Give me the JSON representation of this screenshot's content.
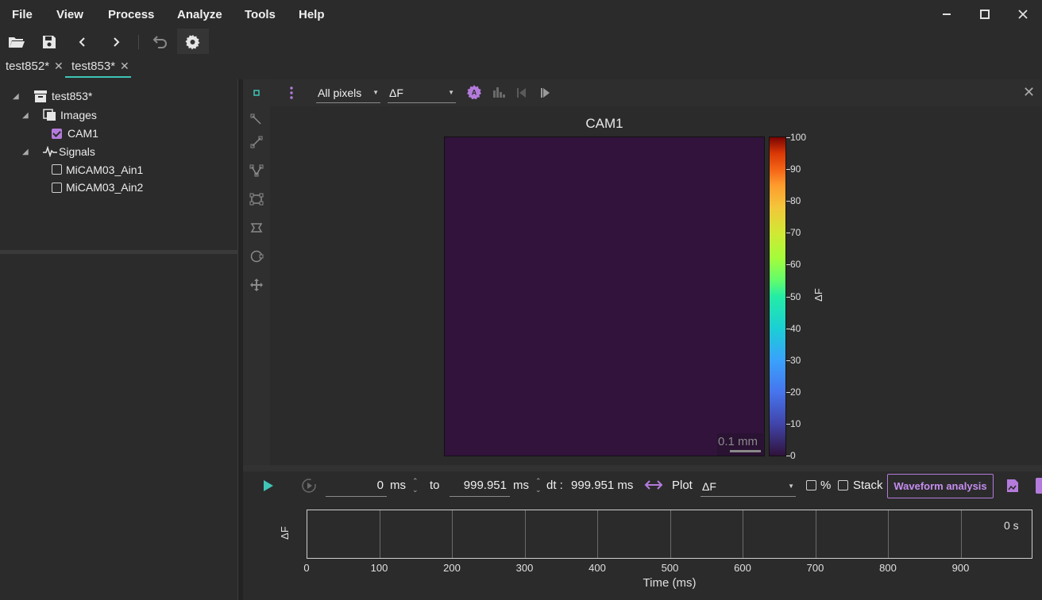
{
  "menu": {
    "items": [
      "File",
      "View",
      "Process",
      "Analyze",
      "Tools",
      "Help"
    ]
  },
  "window": {
    "minimize": "─",
    "maximize": "☐",
    "close": "✕"
  },
  "tabs": [
    {
      "label": "test852*"
    },
    {
      "label": "test853*"
    }
  ],
  "tree": {
    "root": "test853*",
    "images_label": "Images",
    "cam": "CAM1",
    "signals_label": "Signals",
    "signal1": "MiCAM03_Ain1",
    "signal2": "MiCAM03_Ain2"
  },
  "viewer": {
    "pixel_select": "All pixels",
    "mode_select": "ΔF",
    "title": "CAM1",
    "scalebar": "0.1 mm",
    "colorbar_ticks": [
      "100",
      "90",
      "80",
      "70",
      "60",
      "50",
      "40",
      "30",
      "20",
      "10",
      "0"
    ],
    "colorbar_label": "ΔF"
  },
  "controls": {
    "start_value": "0",
    "start_unit": "ms",
    "to_label": "to",
    "end_value": "999.951",
    "end_unit": "ms",
    "dt_label": "dt :",
    "dt_value": "999.951 ms",
    "plot_label": "Plot",
    "plot_select": "ΔF",
    "percent_label": "%",
    "stack_label": "Stack",
    "waveform_button": "Waveform analysis"
  },
  "trace": {
    "ylabel": "ΔF",
    "time_label": "0 s",
    "xlabel": "Time (ms)",
    "xticks": [
      "0",
      "100",
      "200",
      "300",
      "400",
      "500",
      "600",
      "700",
      "800",
      "900"
    ]
  },
  "colors": {
    "accent": "#b47bdc",
    "teal": "#3fc6b7",
    "image_bg": "#31133c"
  }
}
